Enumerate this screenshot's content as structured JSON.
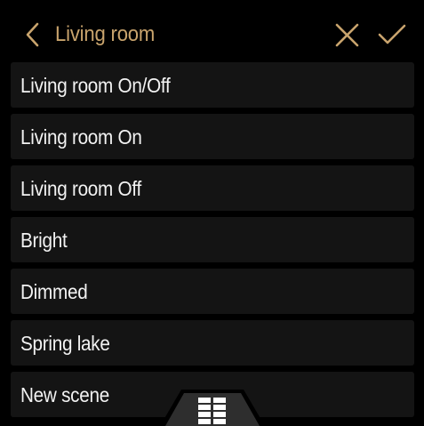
{
  "header": {
    "back_icon": "chevron-left-icon",
    "title": "Living room",
    "close_icon": "close-icon",
    "confirm_icon": "check-icon",
    "accent_color": "#c9a46d"
  },
  "scenes": [
    {
      "label": "Living room On/Off"
    },
    {
      "label": "Living room On"
    },
    {
      "label": "Living room Off"
    },
    {
      "label": "Bright"
    },
    {
      "label": "Dimmed"
    },
    {
      "label": "Spring lake"
    },
    {
      "label": "New scene"
    }
  ],
  "bottom_tab": {
    "icon": "grid-menu-icon"
  },
  "colors": {
    "background": "#000000",
    "row": "#141414",
    "text": "#f2f2f2",
    "tab": "#2e2e2e"
  }
}
